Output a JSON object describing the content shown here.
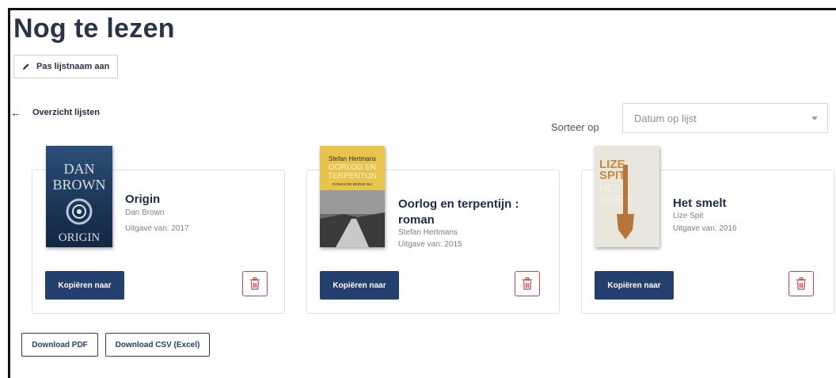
{
  "header": {
    "title": "Nog te lezen",
    "rename_label": "Pas lijstnaam aan"
  },
  "nav": {
    "back_label": "Overzicht lijsten"
  },
  "sort": {
    "label": "Sorteer op",
    "selected": "Datum op lijst"
  },
  "books": [
    {
      "title": "Origin",
      "author": "Dan Brown",
      "published": "Uitgave van: 2017",
      "copy_label": "Kopiëren naar",
      "cover_text": [
        "DAN",
        "BROWN",
        "ORIGIN"
      ]
    },
    {
      "title_line1": "Oorlog en terpentijn :",
      "title_line2": "roman",
      "author": "Stefan Hertmans",
      "published": "Uitgave van: 2015",
      "copy_label": "Kopiëren naar",
      "cover_text": [
        "Stefan Hertmans",
        "OORLOG EN",
        "TERPENTIJN",
        "ROMAN DE BEZIGE BIJ"
      ]
    },
    {
      "title": "Het smelt",
      "author": "Lize Spit",
      "published": "Uitgave van: 2016",
      "copy_label": "Kopiëren naar",
      "cover_text": [
        "LIZE",
        "SPIT",
        "HET",
        "SMELT"
      ]
    }
  ],
  "downloads": {
    "pdf_label": "Download PDF",
    "csv_label": "Download CSV (Excel)"
  },
  "colors": {
    "primary": "#23406e",
    "danger": "#d7434a",
    "text": "#1f2a44"
  }
}
